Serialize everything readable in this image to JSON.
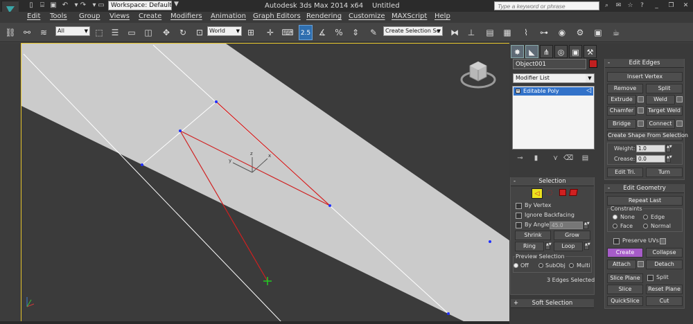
{
  "title_bar": {
    "workspace": "Workspace: Default",
    "app_title": "Autodesk 3ds Max  2014 x64",
    "document": "Untitled",
    "search_placeholder": "Type a keyword or phrase"
  },
  "menu": [
    "Edit",
    "Tools",
    "Group",
    "Views",
    "Create",
    "Modifiers",
    "Animation",
    "Graph Editors",
    "Rendering",
    "Customize",
    "MAXScript",
    "Help"
  ],
  "toolbar": {
    "selection_filter": "All",
    "reference_coord": "World",
    "snap_value": "2.5",
    "named_selection": "Create Selection Se"
  },
  "command_panel": {
    "object_name": "Object001",
    "object_color": "#c02020",
    "modifier_list": "Modifier List",
    "stack": [
      "Editable Poly"
    ],
    "selection": {
      "title": "Selection",
      "by_vertex": "By Vertex",
      "ignore_backfacing": "Ignore Backfacing",
      "by_angle": "By Angle:",
      "angle_value": "45.0",
      "shrink": "Shrink",
      "grow": "Grow",
      "ring": "Ring",
      "loop": "Loop",
      "preview_title": "Preview Selection",
      "preview_off": "Off",
      "preview_subobj": "SubObj",
      "preview_multi": "Multi",
      "status": "3 Edges Selected"
    },
    "soft_selection": "Soft Selection",
    "edit_edges": {
      "title": "Edit Edges",
      "insert_vertex": "Insert Vertex",
      "remove": "Remove",
      "split": "Split",
      "extrude": "Extrude",
      "weld": "Weld",
      "chamfer": "Chamfer",
      "target_weld": "Target Weld",
      "bridge": "Bridge",
      "connect": "Connect",
      "create_shape": "Create Shape From Selection",
      "weight_label": "Weight:",
      "weight_value": "1.0",
      "crease_label": "Crease:",
      "crease_value": "0.0",
      "edit_tri": "Edit Tri.",
      "turn": "Turn"
    },
    "edit_geometry": {
      "title": "Edit Geometry",
      "repeat_last": "Repeat Last",
      "constraints": "Constraints",
      "c_none": "None",
      "c_edge": "Edge",
      "c_face": "Face",
      "c_normal": "Normal",
      "preserve_uvs": "Preserve UVs",
      "create": "Create",
      "collapse": "Collapse",
      "attach": "Attach",
      "detach": "Detach",
      "slice_plane": "Slice Plane",
      "split": "Split",
      "slice": "Slice",
      "reset_plane": "Reset Plane",
      "quickslice": "QuickSlice",
      "cut": "Cut"
    }
  },
  "viewport": {
    "gizmo_x": "x",
    "gizmo_y": "y",
    "gizmo_z": "z"
  }
}
